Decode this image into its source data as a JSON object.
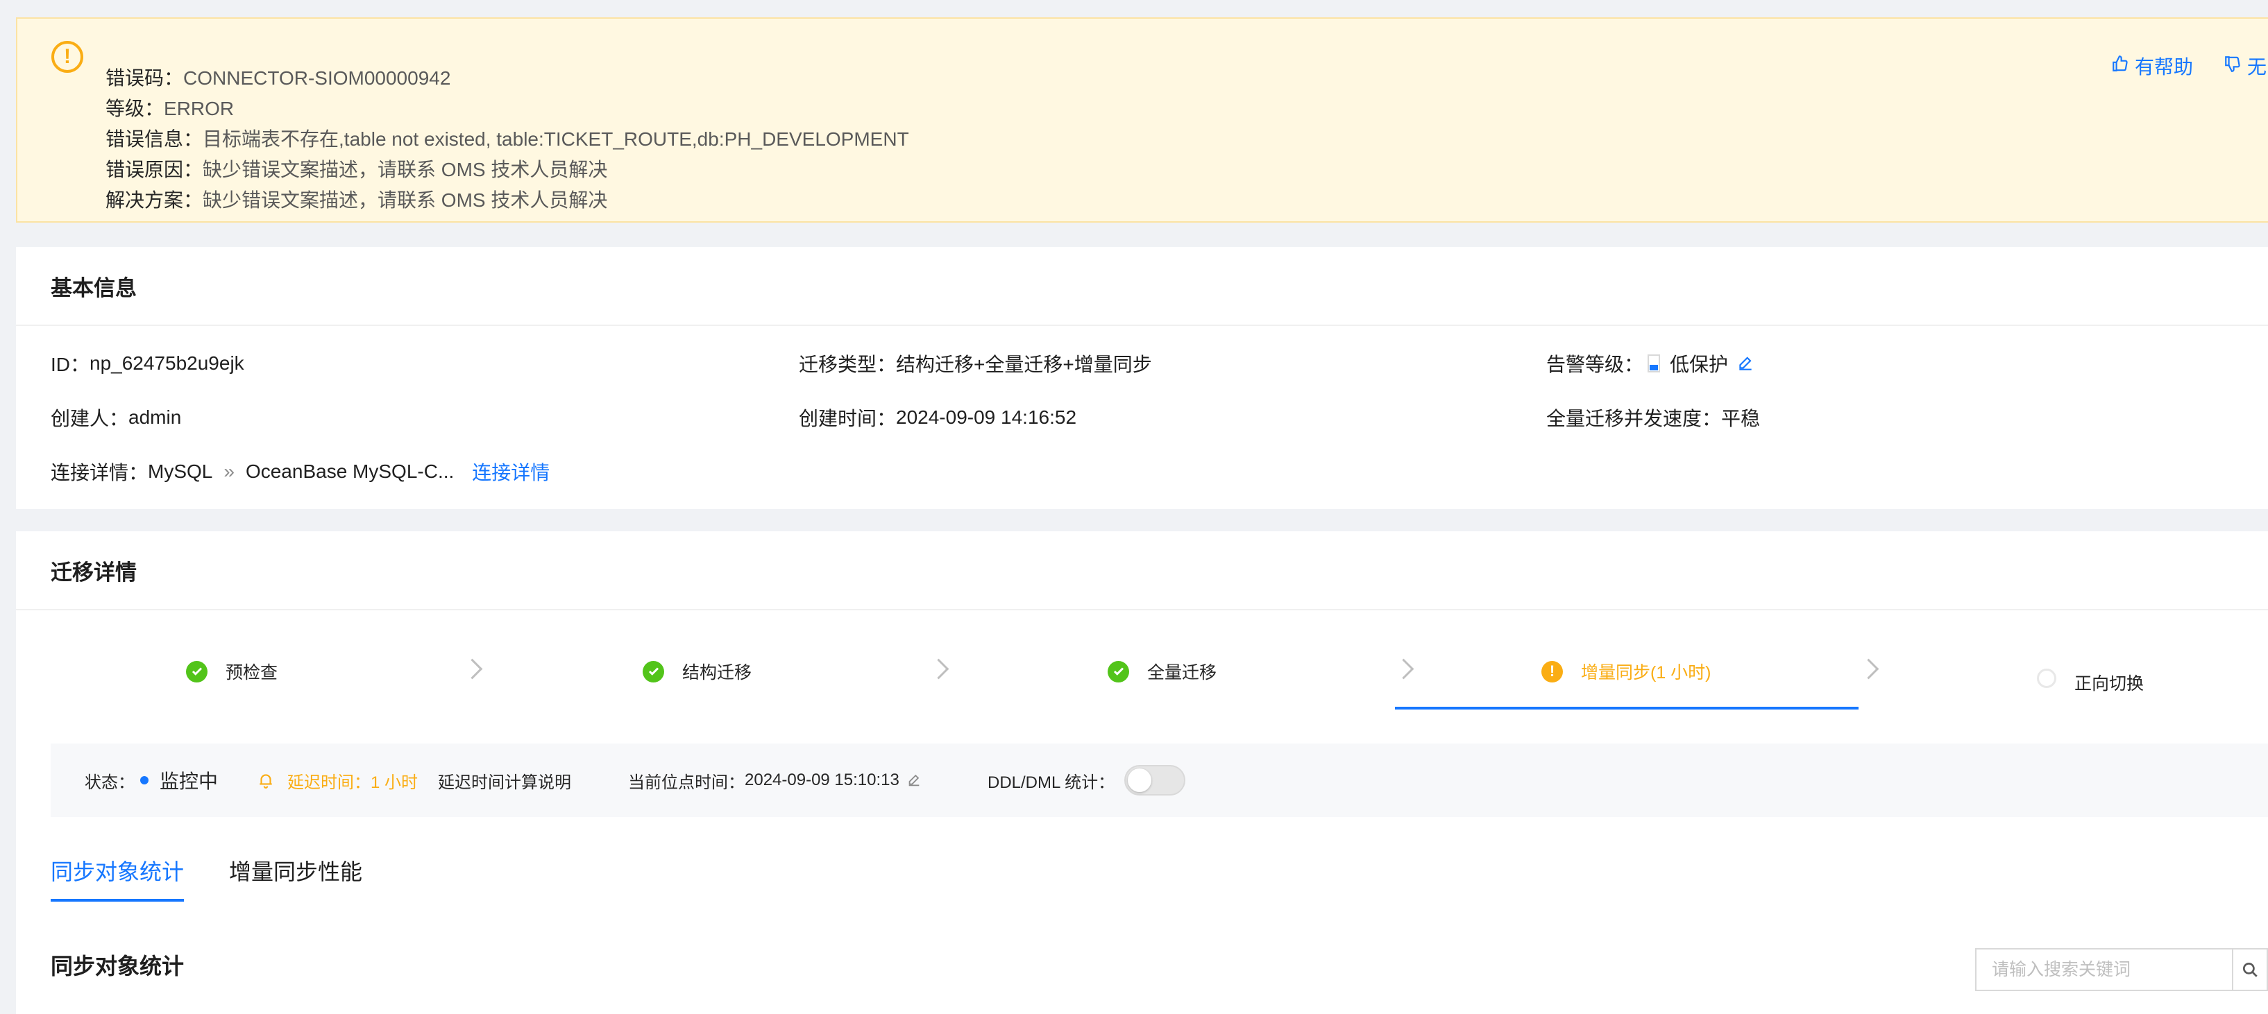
{
  "error": {
    "lines": [
      {
        "label": "错误码：",
        "value": "CONNECTOR-SIOM00000942"
      },
      {
        "label": "等级：",
        "value": "ERROR"
      },
      {
        "label": "错误信息：",
        "value": "目标端表不存在,table not existed, table:TICKET_ROUTE,db:PH_DEVELOPMENT"
      },
      {
        "label": "错误原因：",
        "value": "缺少错误文案描述，请联系 OMS 技术人员解决"
      },
      {
        "label": "解决方案：",
        "value": "缺少错误文案描述，请联系 OMS 技术人员解决"
      }
    ],
    "helpful_label": "有帮助",
    "unhelpful_label": "无"
  },
  "basic": {
    "title": "基本信息",
    "id_label": "ID：",
    "id_value": "np_62475b2u9ejk",
    "type_label": "迁移类型：",
    "type_value": "结构迁移+全量迁移+增量同步",
    "alarm_label": "告警等级：",
    "alarm_value": "低保护",
    "creator_label": "创建人：",
    "creator_value": "admin",
    "created_label": "创建时间：",
    "created_value": "2024-09-09 14:16:52",
    "speed_label": "全量迁移并发速度：",
    "speed_value": "平稳",
    "conn_label": "连接详情：",
    "conn_source": "MySQL",
    "conn_arrow": "»",
    "conn_target": "OceanBase MySQL-C...",
    "conn_link": "连接详情"
  },
  "migration": {
    "title": "迁移详情",
    "steps": [
      {
        "label": "预检查",
        "status": "done"
      },
      {
        "label": "结构迁移",
        "status": "done"
      },
      {
        "label": "全量迁移",
        "status": "done"
      },
      {
        "label": "增量同步(1 小时)",
        "status": "warning"
      },
      {
        "label": "正向切换",
        "status": "waiting"
      }
    ],
    "colors": {
      "done": "#52c41a",
      "warning": "#faad14",
      "active_line": "#1677ff",
      "link": "#1677ff"
    }
  },
  "status_bar": {
    "state_label": "状态：",
    "state_value": "监控中",
    "delay_text": "延迟时间：1 小时",
    "delay_link": "延迟时间计算说明",
    "position_label": "当前位点时间：",
    "position_value": "2024-09-09 15:10:13",
    "ddl_label": "DDL/DML 统计：",
    "ddl_toggle_on": false
  },
  "tabs": [
    {
      "label": "同步对象统计",
      "active": true
    },
    {
      "label": "增量同步性能",
      "active": false
    }
  ],
  "section": {
    "title": "同步对象统计",
    "search_placeholder": "请输入搜索关键词"
  }
}
